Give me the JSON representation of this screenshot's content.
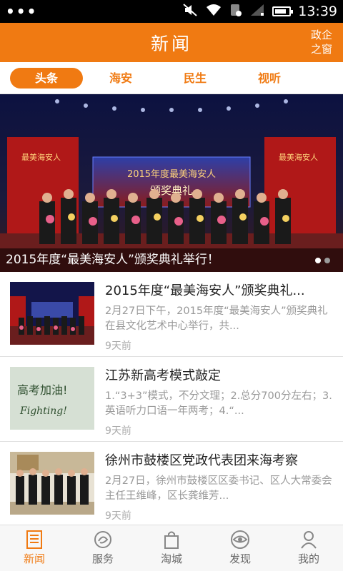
{
  "status_bar": {
    "time": "13:39",
    "dots": "•••",
    "icons": [
      "mute-icon",
      "wifi-icon",
      "sim-icon",
      "signal-icon",
      "battery-icon"
    ]
  },
  "header": {
    "title": "新闻",
    "gov_line1": "政企",
    "gov_line2": "之窗"
  },
  "tabs": [
    {
      "label": "头条",
      "active": true
    },
    {
      "label": "海安",
      "active": false
    },
    {
      "label": "民生",
      "active": false
    },
    {
      "label": "视听",
      "active": false
    }
  ],
  "banner": {
    "caption": "2015年度“最美海安人”颁奖典礼举行！",
    "screen_title": "2015年度最美海安人",
    "screen_subtitle": "颁奖典礼",
    "side_text": "最美海安人",
    "pages": 2,
    "active_page": 0
  },
  "news": [
    {
      "title": "2015年度“最美海安人”颁奖典礼...",
      "desc": "2月27日下午，2015年度“最美海安人”颁奖典礼在县文化艺术中心举行，共...",
      "time": "9天前",
      "thumb": "ceremony"
    },
    {
      "title": "江苏新高考模式敲定",
      "desc": "1.“3+3”模式，不分文理；2.总分700分左右；3.英语听力口语一年两考；4.“...",
      "time": "9天前",
      "thumb": "handwriting",
      "thumb_text_1": "高考加油!",
      "thumb_text_2": "Fighting!"
    },
    {
      "title": "徐州市鼓楼区党政代表团来海考察",
      "desc": "2月27日，徐州市鼓楼区区委书记、区人大常委会主任王维峰，区长龚维芳...",
      "time": "9天前",
      "thumb": "delegation"
    }
  ],
  "bottom_nav": [
    {
      "label": "新闻",
      "icon": "news-icon",
      "active": true
    },
    {
      "label": "服务",
      "icon": "service-icon",
      "active": false
    },
    {
      "label": "淘城",
      "icon": "shopping-bag-icon",
      "active": false
    },
    {
      "label": "发现",
      "icon": "eye-icon",
      "active": false
    },
    {
      "label": "我的",
      "icon": "user-icon",
      "active": false
    }
  ],
  "colors": {
    "accent": "#f07a12",
    "text": "#222222",
    "muted": "#999999"
  }
}
